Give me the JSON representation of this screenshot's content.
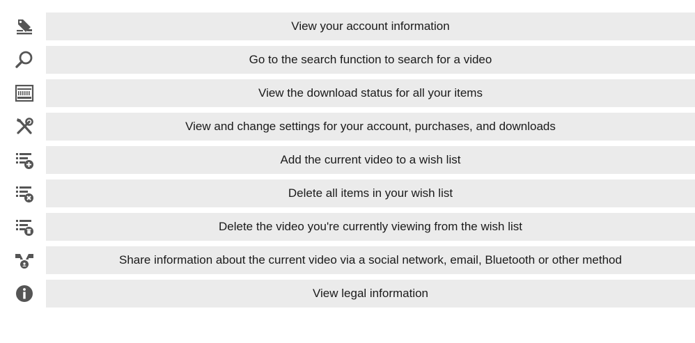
{
  "rows": [
    {
      "icon": "account-icon",
      "text": "View your account information"
    },
    {
      "icon": "search-icon",
      "text": "Go to the search function to search for a video"
    },
    {
      "icon": "download-status-icon",
      "text": "View the download status for all your items"
    },
    {
      "icon": "settings-icon",
      "text": "View and change settings for your account, purchases, and downloads"
    },
    {
      "icon": "wishlist-add-icon",
      "text": "Add the current video to a wish list"
    },
    {
      "icon": "wishlist-delete-all-icon",
      "text": "Delete all items in your wish list"
    },
    {
      "icon": "wishlist-delete-video-icon",
      "text": "Delete the video you're currently viewing from the wish list"
    },
    {
      "icon": "share-icon",
      "text": "Share information about the current video via a social network, email, Bluetooth or other method"
    },
    {
      "icon": "info-icon",
      "text": "View legal information"
    }
  ],
  "colors": {
    "row_background": "#ebebeb",
    "icon": "#555555",
    "text": "#1a1a1a"
  }
}
